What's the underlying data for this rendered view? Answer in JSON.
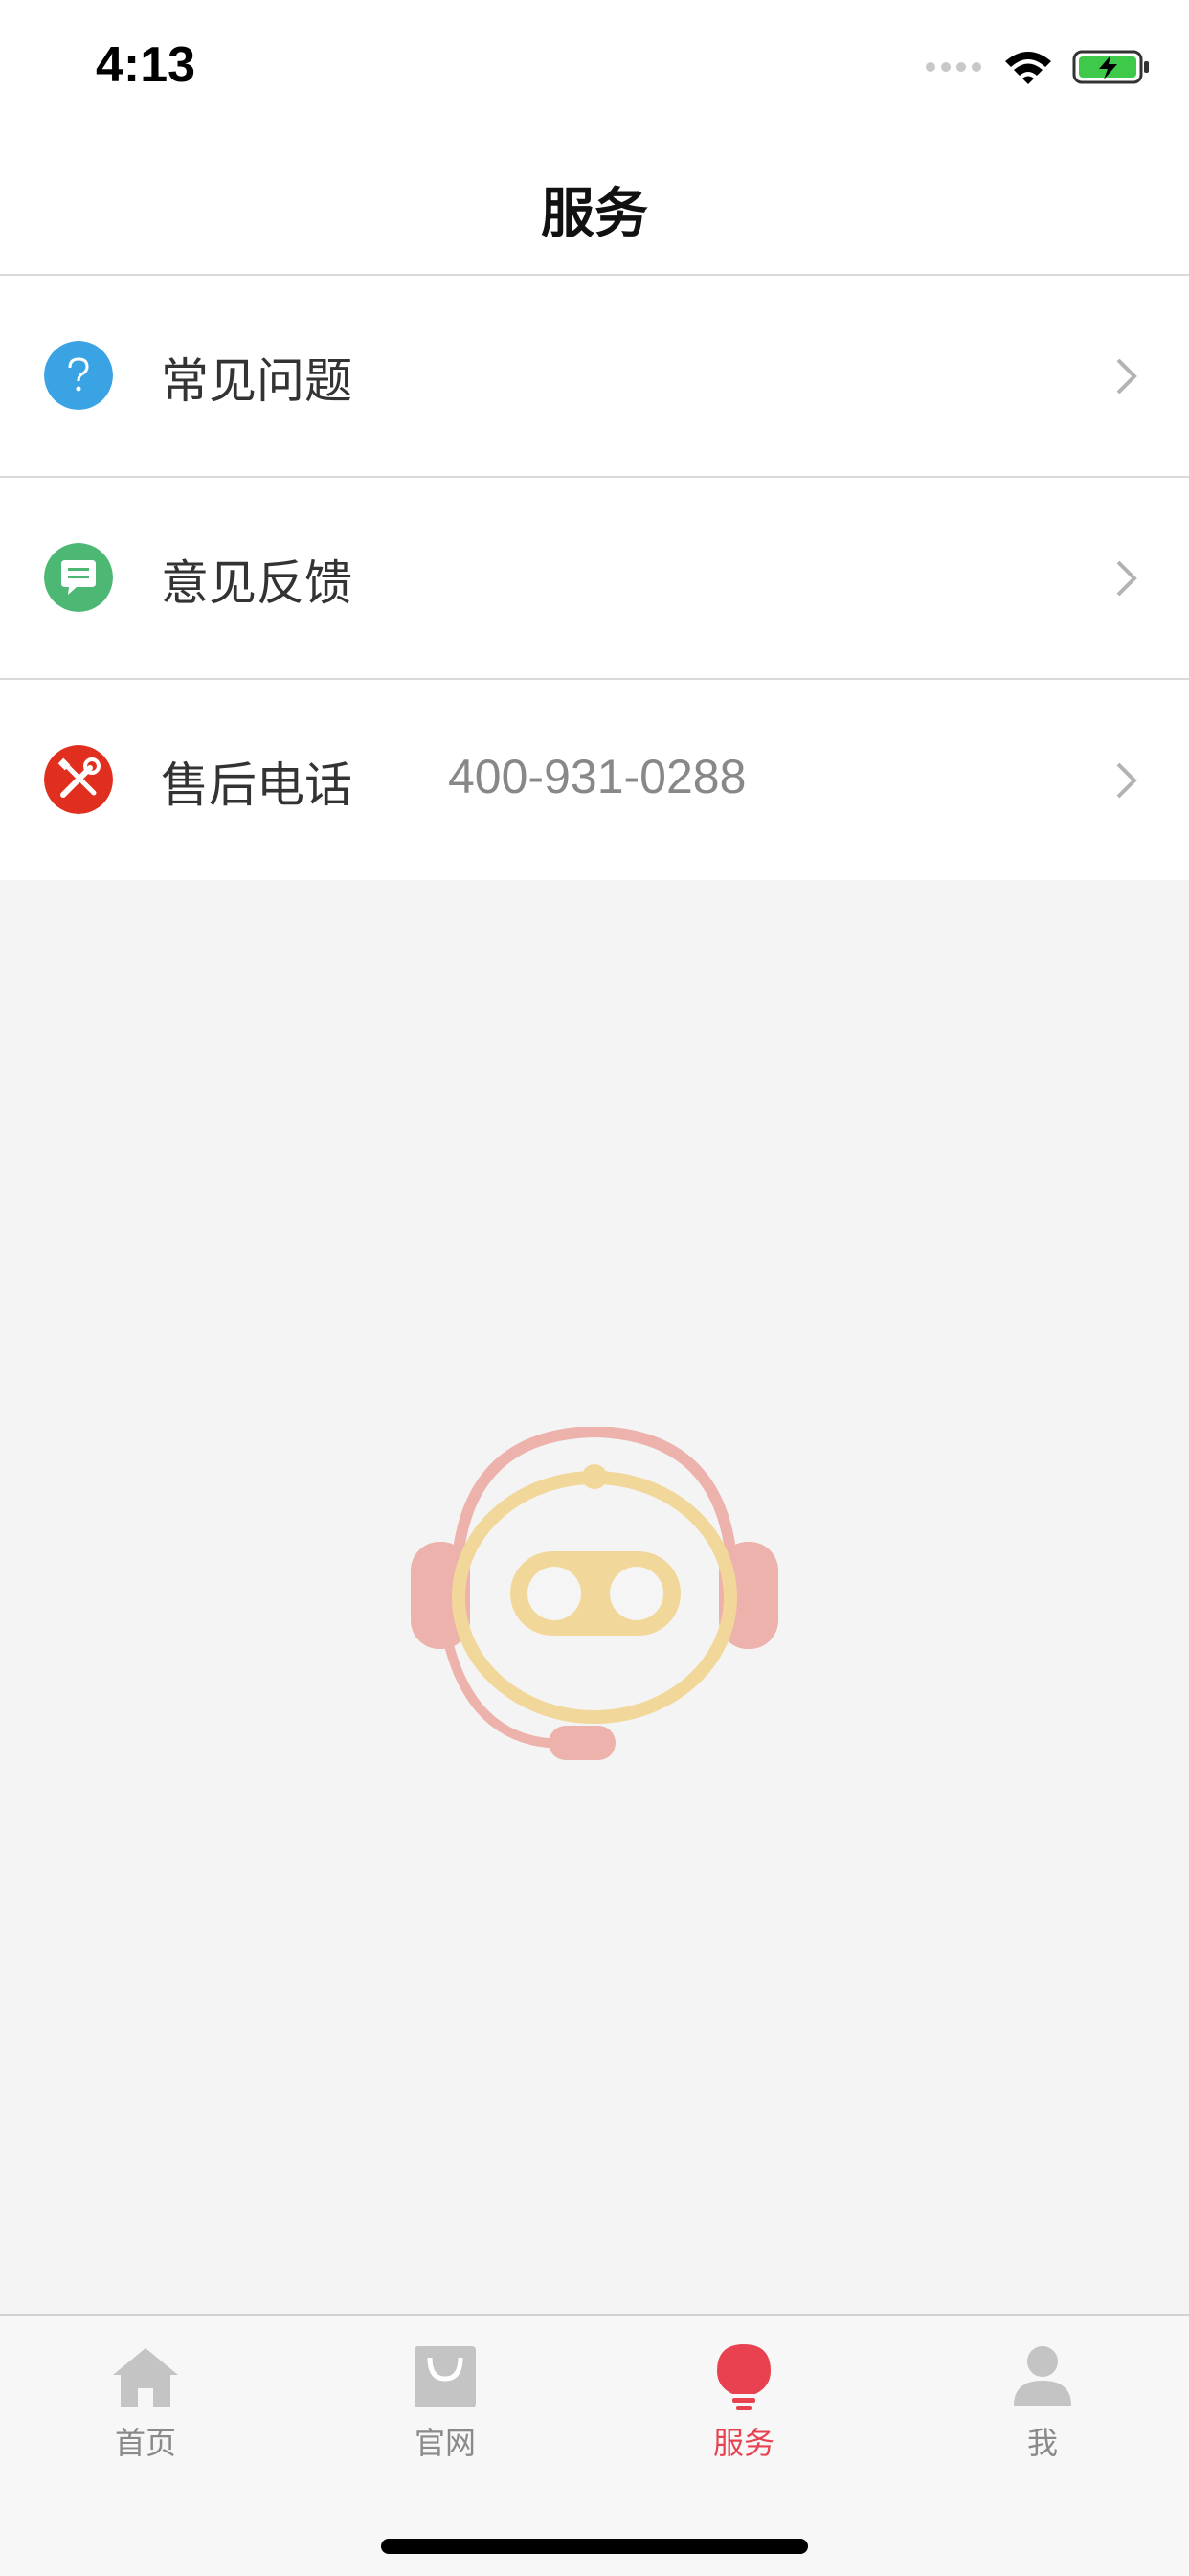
{
  "status_bar": {
    "time": "4:13"
  },
  "nav": {
    "title": "服务"
  },
  "list": [
    {
      "label": "常见问题",
      "value": "",
      "icon": "question-icon",
      "icon_color": "#3aa3e3"
    },
    {
      "label": "意见反馈",
      "value": "",
      "icon": "chat-bubble-icon",
      "icon_color": "#4db874"
    },
    {
      "label": "售后电话",
      "value": "400-931-0288",
      "icon": "tools-icon",
      "icon_color": "#e02f1f"
    }
  ],
  "tabs": [
    {
      "label": "首页",
      "icon": "home-icon",
      "active": false
    },
    {
      "label": "官网",
      "icon": "shopping-bag-icon",
      "active": false
    },
    {
      "label": "服务",
      "icon": "lightbulb-icon",
      "active": true
    },
    {
      "label": "我",
      "icon": "person-icon",
      "active": false
    }
  ],
  "colors": {
    "accent": "#e84250",
    "inactive": "#c4c4c4",
    "background": "#f4f4f4"
  }
}
